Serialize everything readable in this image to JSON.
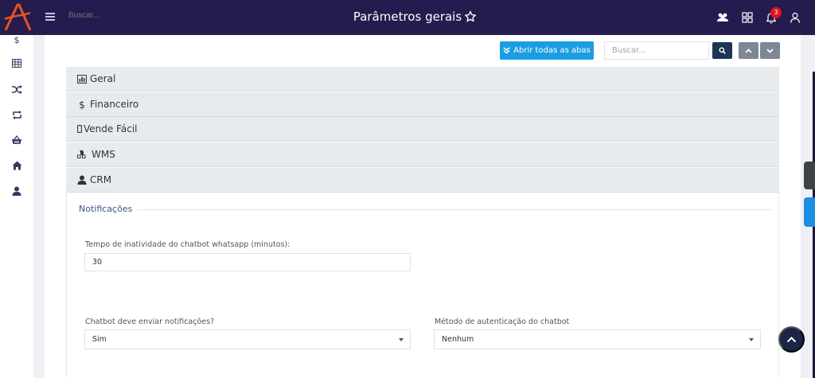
{
  "header": {
    "search_placeholder": "Buscar...",
    "title": "Parâmetros gerais",
    "notification_count": "3",
    "icons": [
      "logo-icon",
      "menu-icon",
      "star-icon",
      "users-icon",
      "grid-icon",
      "bell-icon",
      "user-icon"
    ]
  },
  "sidebar": {
    "items": [
      {
        "icon": "dollar-icon"
      },
      {
        "icon": "table-icon"
      },
      {
        "icon": "shuffle-icon"
      },
      {
        "icon": "repeat-icon"
      },
      {
        "icon": "basket-icon"
      },
      {
        "icon": "home-icon"
      },
      {
        "icon": "user-icon"
      }
    ]
  },
  "toolbar": {
    "open_all_label": "Abrir todas as abas",
    "search_placeholder": "Buscar..."
  },
  "accordion": [
    {
      "label": "Geral",
      "icon": "bar-chart-icon"
    },
    {
      "label": "Financeiro",
      "icon": "dollar-icon"
    },
    {
      "label": "Vende Fácil",
      "icon": "mobile-icon"
    },
    {
      "label": "WMS",
      "icon": "cubes-icon"
    },
    {
      "label": "CRM",
      "icon": "user-icon"
    }
  ],
  "crm": {
    "section_title": "Notificações",
    "inactivity": {
      "label": "Tempo de inatividade do chatbot whatsapp (minutos):",
      "value": "30"
    },
    "send_notifications": {
      "label": "Chatbot deve enviar notificações?",
      "value": "Sim"
    },
    "auth_method": {
      "label": "Método de autenticação do chatbot",
      "value": "Nenhum"
    }
  },
  "colors": {
    "topbar": "#251b4e",
    "primary_button": "#1a9ee3",
    "search_button": "#1d3557",
    "nav_button": "#7d8894",
    "badge": "#e0141e",
    "scroll_top": "#1b2547"
  }
}
